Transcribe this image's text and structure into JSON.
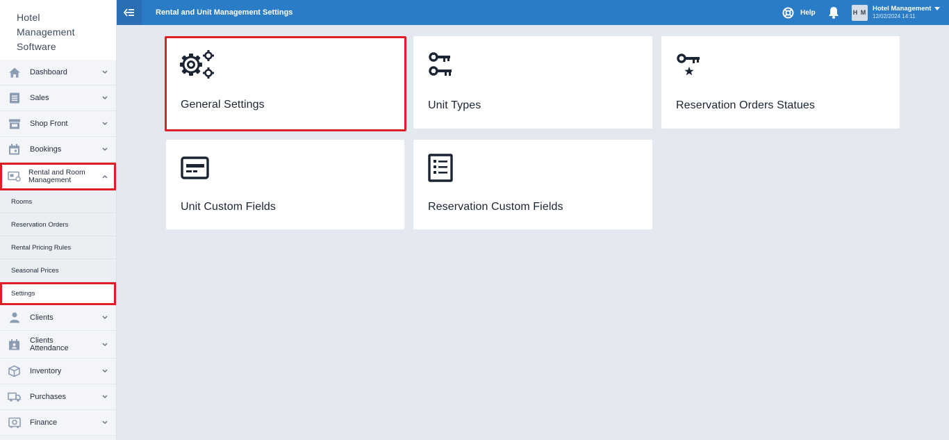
{
  "brand": {
    "line1": "Hotel",
    "line2": "Management",
    "line3": "Software"
  },
  "sidebar": {
    "items": [
      {
        "label": "Dashboard",
        "icon": "home-icon"
      },
      {
        "label": "Sales",
        "icon": "receipt-icon"
      },
      {
        "label": "Shop Front",
        "icon": "store-icon"
      },
      {
        "label": "Bookings",
        "icon": "calendar-icon"
      },
      {
        "label": "Rental and Room Management",
        "label_line1": "Rental and Room",
        "label_line2": "Management",
        "icon": "rental-icon",
        "expanded": true
      },
      {
        "label": "Clients",
        "icon": "person-icon"
      },
      {
        "label": "Clients Attendance",
        "label_line1": "Clients",
        "label_line2": "Attendance",
        "icon": "attendance-icon"
      },
      {
        "label": "Inventory",
        "icon": "box-icon"
      },
      {
        "label": "Purchases",
        "icon": "truck-icon"
      },
      {
        "label": "Finance",
        "icon": "safe-icon"
      }
    ],
    "subitems": [
      "Rooms",
      "Reservation Orders",
      "Rental Pricing Rules",
      "Seasonal Prices",
      "Settings"
    ]
  },
  "topbar": {
    "title": "Rental and Unit Management Settings",
    "help": "Help",
    "user_initials": "H M",
    "user_name": "Hotel Management",
    "user_date": "12/02/2024 14:11"
  },
  "cards": [
    {
      "title": "General Settings",
      "icon": "gears-icon"
    },
    {
      "title": "Unit Types",
      "icon": "keys-icon"
    },
    {
      "title": "Reservation Orders Statues",
      "icon": "key-star-icon"
    },
    {
      "title": "Unit Custom Fields",
      "icon": "card-fields-icon"
    },
    {
      "title": "Reservation Custom Fields",
      "icon": "list-fields-icon"
    }
  ],
  "colors": {
    "topbar": "#2b7cc6",
    "highlight": "#e01e26",
    "background": "#e4e9f1"
  }
}
